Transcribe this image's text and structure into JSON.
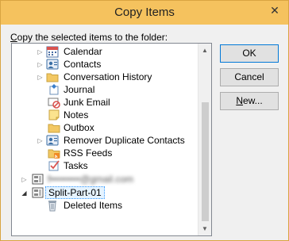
{
  "window": {
    "title": "Copy Items",
    "close_glyph": "✕"
  },
  "prompt": {
    "accel": "C",
    "rest": "opy the selected items to the folder:"
  },
  "tree": {
    "items": [
      {
        "label": "Calendar",
        "icon": "calendar-icon",
        "expander": "▷"
      },
      {
        "label": "Contacts",
        "icon": "contacts-icon",
        "expander": "▷"
      },
      {
        "label": "Conversation History",
        "icon": "folder-icon",
        "expander": "▷"
      },
      {
        "label": "Journal",
        "icon": "journal-icon",
        "expander": ""
      },
      {
        "label": "Junk Email",
        "icon": "junk-email-icon",
        "expander": ""
      },
      {
        "label": "Notes",
        "icon": "notes-icon",
        "expander": ""
      },
      {
        "label": "Outbox",
        "icon": "outbox-icon",
        "expander": ""
      },
      {
        "label": "Remover Duplicate Contacts",
        "icon": "contacts-icon",
        "expander": "▷"
      },
      {
        "label": "RSS Feeds",
        "icon": "rss-icon",
        "expander": ""
      },
      {
        "label": "Tasks",
        "icon": "tasks-icon",
        "expander": ""
      },
      {
        "label": "f•••••••••@gmail.com",
        "icon": "mailbox-icon",
        "expander": "▷"
      },
      {
        "label": "Split-Part-01",
        "icon": "mailbox-icon",
        "expander": "◢"
      },
      {
        "label": "Deleted Items",
        "icon": "trash-icon",
        "expander": ""
      }
    ]
  },
  "buttons": {
    "ok": "OK",
    "cancel": "Cancel",
    "new_accel": "N",
    "new_rest": "ew..."
  },
  "colors": {
    "title_bar": "#f5c25e",
    "selection_border": "#3399ff",
    "default_button_border": "#0078d7"
  }
}
